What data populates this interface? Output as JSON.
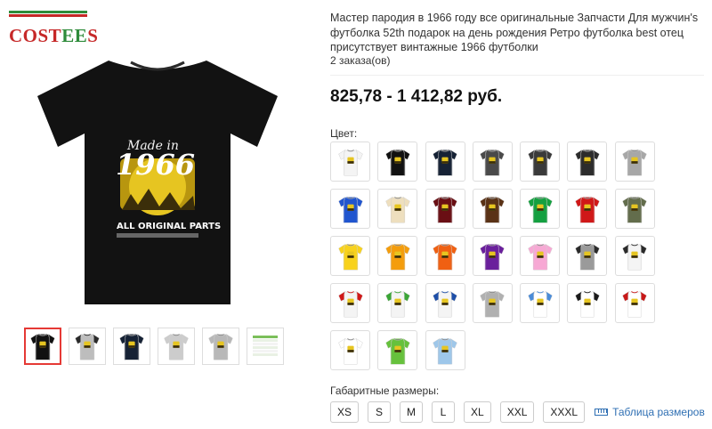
{
  "brand": {
    "part1": "COST",
    "part2": "EE",
    "part3": "S"
  },
  "product": {
    "title": "Мастер пародия в 1966 году все оригинальные Запчасти Для мужчин's футболка 52th подарок на день рождения Ретро футболка best отец присутствует винтажные 1966 футболки",
    "orders": "2 заказа(ов)",
    "price": "825,78 - 1 412,82 руб.",
    "print": {
      "line1": "Made in",
      "line2": "1966",
      "line3": "ALL ORIGINAL PARTS"
    }
  },
  "colors": {
    "label": "Цвет:",
    "swatches": [
      {
        "body": "#f4f4f4",
        "sleeve": "#f4f4f4"
      },
      {
        "body": "#111111",
        "sleeve": "#111111"
      },
      {
        "body": "#162235",
        "sleeve": "#162235"
      },
      {
        "body": "#4a4a4a",
        "sleeve": "#4a4a4a"
      },
      {
        "body": "#3a3a3a",
        "sleeve": "#3a3a3a"
      },
      {
        "body": "#2c2c2c",
        "sleeve": "#2c2c2c"
      },
      {
        "body": "#a7a7a7",
        "sleeve": "#a7a7a7"
      },
      {
        "body": "#2055cf",
        "sleeve": "#2055cf"
      },
      {
        "body": "#eedfbe",
        "sleeve": "#eedfbe"
      },
      {
        "body": "#6a0f14",
        "sleeve": "#6a0f14"
      },
      {
        "body": "#5a3216",
        "sleeve": "#5a3216"
      },
      {
        "body": "#14a040",
        "sleeve": "#14a040"
      },
      {
        "body": "#d01818",
        "sleeve": "#d01818"
      },
      {
        "body": "#636d4c",
        "sleeve": "#636d4c"
      },
      {
        "body": "#f8d21c",
        "sleeve": "#f8d21c"
      },
      {
        "body": "#f49d0c",
        "sleeve": "#f49d0c"
      },
      {
        "body": "#f06012",
        "sleeve": "#f06012"
      },
      {
        "body": "#6a1f9c",
        "sleeve": "#6a1f9c"
      },
      {
        "body": "#f7a8d4",
        "sleeve": "#f7a8d4"
      },
      {
        "body": "#9a9a9a",
        "sleeve": "#2a2a2a"
      },
      {
        "body": "#f4f4f4",
        "sleeve": "#2a2a2a"
      },
      {
        "body": "#f4f4f4",
        "sleeve": "#d01818"
      },
      {
        "body": "#f4f4f4",
        "sleeve": "#3aa636"
      },
      {
        "body": "#f4f4f4",
        "sleeve": "#1e4fa8"
      },
      {
        "body": "#b0b0b0",
        "sleeve": "#b0b0b0"
      },
      {
        "body": "#ffffff",
        "sleeve": "#4a8cd8"
      },
      {
        "body": "#ffffff",
        "sleeve": "#1a1a1a"
      },
      {
        "body": "#ffffff",
        "sleeve": "#c81818"
      },
      {
        "body": "#ffffff",
        "sleeve": "#ffffff"
      },
      {
        "body": "#66c13c",
        "sleeve": "#66c13c"
      },
      {
        "body": "#9ec7ea",
        "sleeve": "#9ec7ea"
      }
    ]
  },
  "thumbnails": [
    {
      "kind": "tee",
      "body": "#111111",
      "sleeve": "#111111"
    },
    {
      "kind": "tee",
      "body": "#bdbdbd",
      "sleeve": "#2a2a2a"
    },
    {
      "kind": "tee",
      "body": "#162235",
      "sleeve": "#162235"
    },
    {
      "kind": "tee",
      "body": "#cccccc",
      "sleeve": "#cccccc"
    },
    {
      "kind": "tee",
      "body": "#b8b8b8",
      "sleeve": "#b8b8b8"
    },
    {
      "kind": "chart"
    }
  ],
  "sizes": {
    "label": "Габаритные размеры:",
    "options": [
      "XS",
      "S",
      "M",
      "L",
      "XL",
      "XXL",
      "XXXL"
    ],
    "chart_link": "Таблица размеров",
    "chart_icon": "ruler-icon"
  },
  "accent": {
    "price": "#111111",
    "selected": "#e53935",
    "link": "#2f6fb3"
  }
}
